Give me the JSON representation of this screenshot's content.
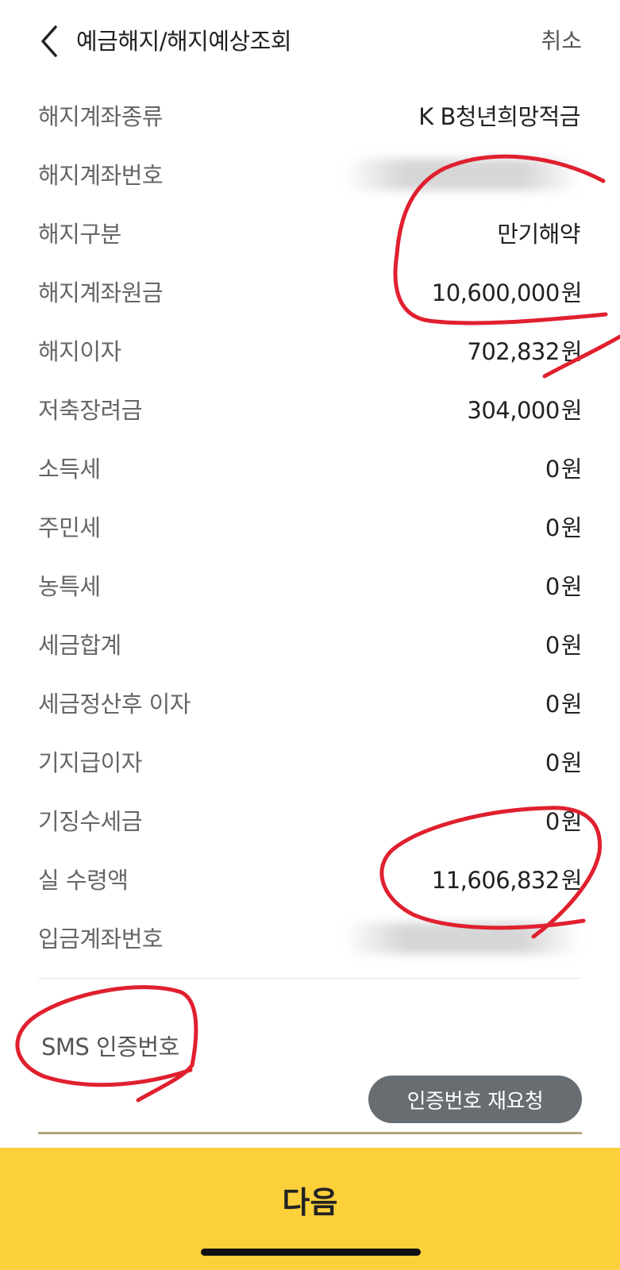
{
  "header": {
    "title": "예금해지/해지예상조회",
    "cancel_label": "취소"
  },
  "rows": [
    {
      "label": "해지계좌종류",
      "value": "K B청년희망적금",
      "unit": ""
    },
    {
      "label": "해지계좌번호",
      "value": "",
      "unit": ""
    },
    {
      "label": "해지구분",
      "value": "만기해약",
      "unit": ""
    },
    {
      "label": "해지계좌원금",
      "value": "10,600,000",
      "unit": "원"
    },
    {
      "label": "해지이자",
      "value": "702,832",
      "unit": "원"
    },
    {
      "label": "저축장려금",
      "value": "304,000",
      "unit": "원"
    },
    {
      "label": "소득세",
      "value": "0",
      "unit": "원"
    },
    {
      "label": "주민세",
      "value": "0",
      "unit": "원"
    },
    {
      "label": "농특세",
      "value": "0",
      "unit": "원"
    },
    {
      "label": "세금합계",
      "value": "0",
      "unit": "원"
    },
    {
      "label": "세금정산후 이자",
      "value": "0",
      "unit": "원"
    },
    {
      "label": "기지급이자",
      "value": "0",
      "unit": "원"
    },
    {
      "label": "기징수세금",
      "value": "0",
      "unit": "원"
    },
    {
      "label": "실 수령액",
      "value": "11,606,832",
      "unit": "원"
    },
    {
      "label": "입금계좌번호",
      "value": "",
      "unit": ""
    }
  ],
  "sms": {
    "label": "SMS 인증번호",
    "resend_button": "인증번호 재요청"
  },
  "footer": {
    "next_button": "다음"
  },
  "colors": {
    "primary_button": "#fcd03a",
    "secondary_button": "#686d72",
    "annotation": "#e0202e"
  }
}
